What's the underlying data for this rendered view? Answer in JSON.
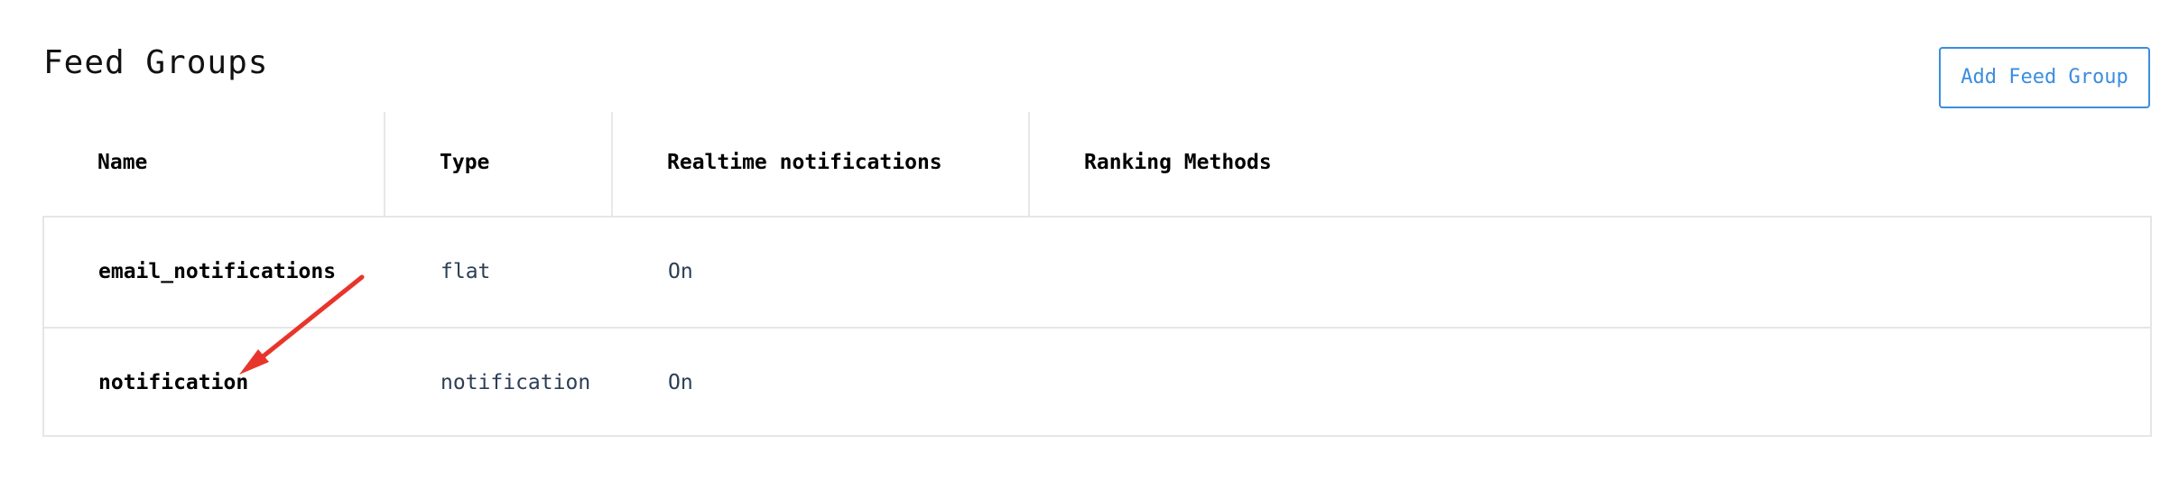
{
  "section": {
    "title": "Feed Groups",
    "add_button_label": "Add Feed Group"
  },
  "table": {
    "headers": [
      "Name",
      "Type",
      "Realtime notifications",
      "Ranking Methods"
    ],
    "rows": [
      {
        "name": "email_notifications",
        "type": "flat",
        "realtime": "On"
      },
      {
        "name": "notification",
        "type": "notification",
        "realtime": "On"
      }
    ]
  },
  "colors": {
    "accent": "#3b8ddf",
    "arrow": "#e8352b",
    "muted_text": "#2c3e55"
  }
}
